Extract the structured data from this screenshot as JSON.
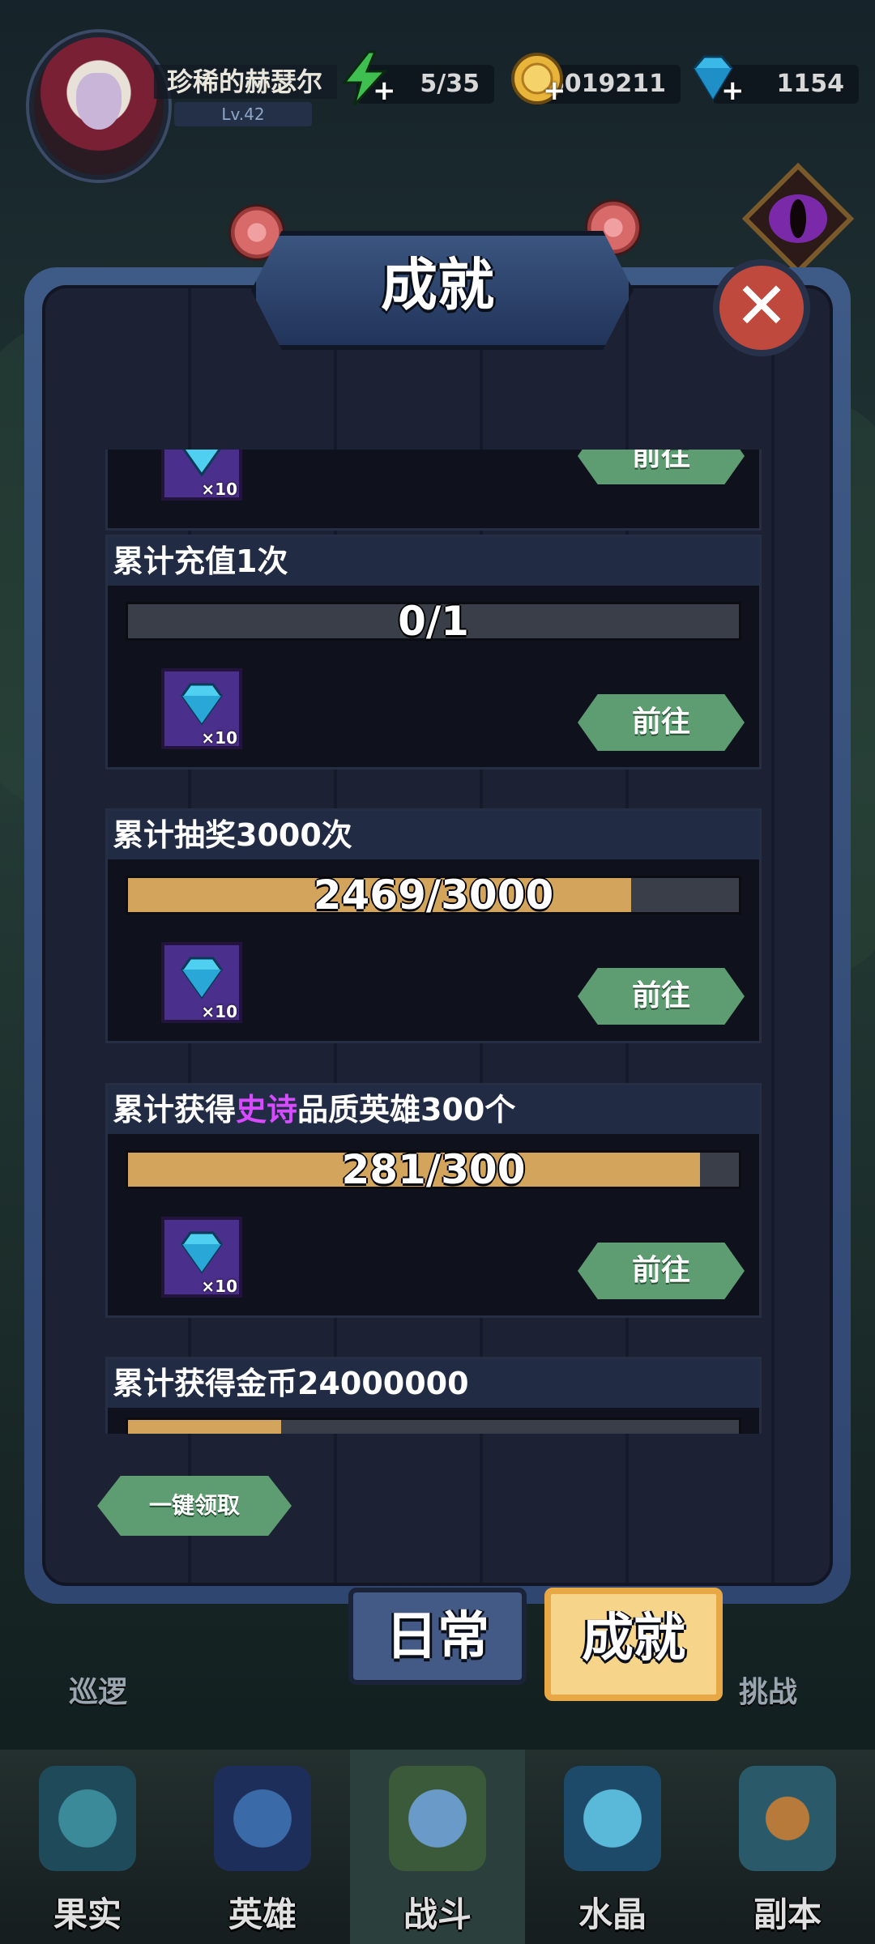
{
  "player": {
    "name": "珍稀的赫瑟尔",
    "level": "Lv.42"
  },
  "resources": {
    "energy": "5/35",
    "gold": "6019211",
    "gems": "1154"
  },
  "panel": {
    "title": "成就",
    "claim_all": "一键领取"
  },
  "achievements": [
    {
      "title": "累计充值1次",
      "progress_text": "0/1",
      "progress": 0.0,
      "reward_qty": "×10",
      "button": "前往"
    },
    {
      "title": "累计抽奖3000次",
      "progress_text": "2469/3000",
      "progress": 0.823,
      "reward_qty": "×10",
      "button": "前往"
    },
    {
      "title_parts": [
        "累计获得",
        "史诗",
        "品质英雄300个"
      ],
      "progress_text": "281/300",
      "progress": 0.937,
      "reward_qty": "×10",
      "button": "前往"
    },
    {
      "title": "累计获得金币24000000",
      "progress_text": "",
      "progress": 0.25,
      "reward_qty": "",
      "button": ""
    }
  ],
  "partial_top": {
    "reward_qty": "×10",
    "button": "前往"
  },
  "tabs": {
    "daily": "日常",
    "achievement": "成就"
  },
  "side_labels": {
    "left": "巡逻",
    "right": "挑战"
  },
  "nav": [
    "果实",
    "英雄",
    "战斗",
    "水晶",
    "副本"
  ],
  "colors": {
    "accent_green": "#5e9c72",
    "progress_gold": "#d2a45c",
    "epic_purple": "#d64bff"
  }
}
